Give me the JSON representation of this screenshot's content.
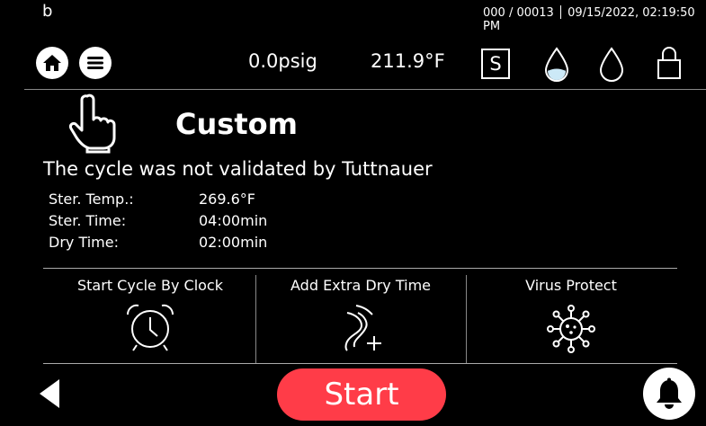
{
  "header": {
    "user": "b",
    "counter": "000 / 00013",
    "datetime": "09/15/2022, 02:19:50 PM",
    "pressure": "0.0psig",
    "temperature": "211.9°F",
    "mode_badge": "S"
  },
  "program": {
    "title": "Custom",
    "notice": "The cycle was not validated by Tuttnauer"
  },
  "parameters": [
    {
      "label": "Ster. Temp.:",
      "value": "269.6°F"
    },
    {
      "label": "Ster. Time:",
      "value": "04:00min"
    },
    {
      "label": "Dry Time:",
      "value": "02:00min"
    }
  ],
  "options": [
    {
      "label": "Start Cycle By Clock",
      "icon": "alarm-clock-icon"
    },
    {
      "label": "Add Extra Dry Time",
      "icon": "add-dry-time-icon"
    },
    {
      "label": "Virus Protect",
      "icon": "virus-icon"
    }
  ],
  "footer": {
    "start_label": "Start"
  },
  "colors": {
    "start": "#ff3c48",
    "water_fill": "#cce9f7",
    "background": "#000000"
  }
}
